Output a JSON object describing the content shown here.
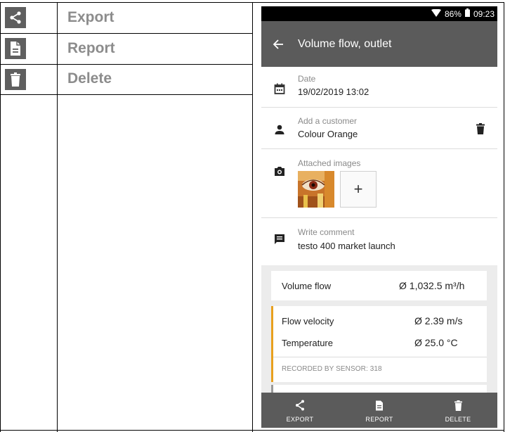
{
  "rows": [
    {
      "icon": "share-icon",
      "label": "Export"
    },
    {
      "icon": "report-icon",
      "label": "Report"
    },
    {
      "icon": "trash-icon",
      "label": "Delete"
    }
  ],
  "phone": {
    "status": {
      "battery": "86%",
      "time": "09:23"
    },
    "appbar": {
      "title": "Volume flow, outlet"
    },
    "date": {
      "label": "Date",
      "value": "19/02/2019 13:02"
    },
    "customer": {
      "label": "Add a customer",
      "value": "Colour Orange"
    },
    "images": {
      "label": "Attached images",
      "add": "+"
    },
    "comment": {
      "label": "Write comment",
      "value": "testo 400 market launch"
    },
    "measurements": {
      "volume_flow": {
        "name": "Volume flow",
        "value": "Ø 1,032.5 m³/h"
      },
      "flow_velocity": {
        "name": "Flow velocity",
        "value": "Ø 2.39 m/s"
      },
      "temperature": {
        "name": "Temperature",
        "value": "Ø 25.0 °C"
      },
      "recorded": "RECORDED BY SENSOR:  318"
    },
    "bottom": {
      "export": "EXPORT",
      "report": "REPORT",
      "delete": "DELETE"
    },
    "accent_color": "#e8a01e"
  }
}
